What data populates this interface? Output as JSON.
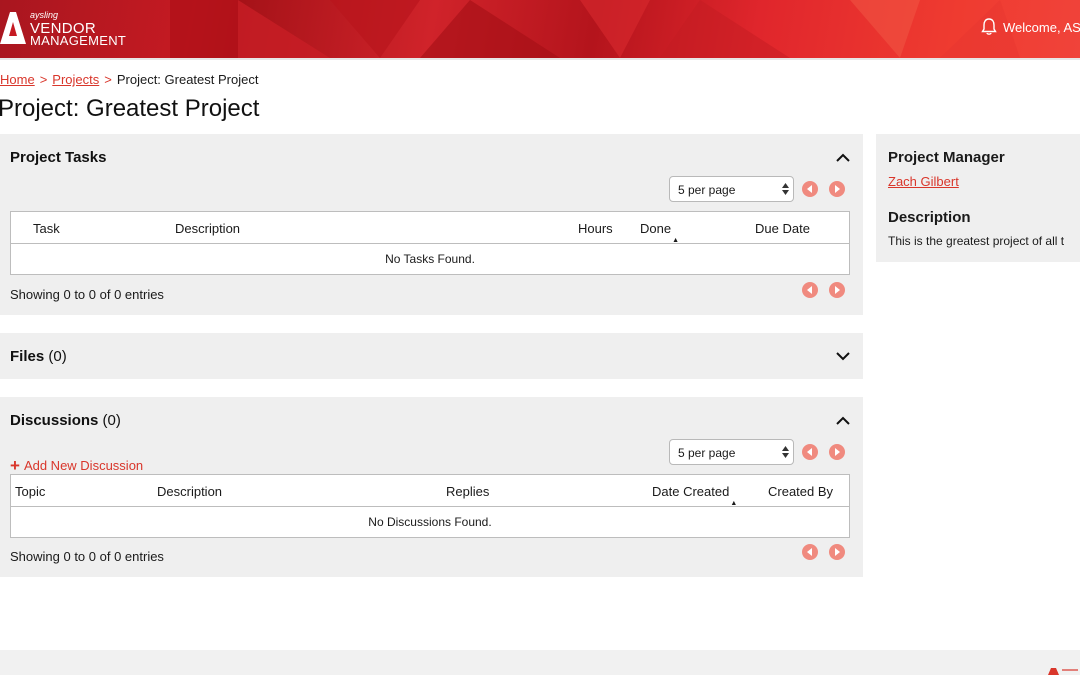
{
  "brand": {
    "small": "aysling",
    "line1": "VENDOR",
    "line2": "MANAGEMENT",
    "accent": "#d9362b"
  },
  "header": {
    "welcome": "Welcome, ASO"
  },
  "breadcrumb": {
    "home": "Home",
    "projects": "Projects",
    "current": "Project: Greatest Project"
  },
  "page": {
    "title": "Project: Greatest Project"
  },
  "tasks": {
    "title": "Project Tasks",
    "per_page": "5 per page",
    "columns": [
      "Task",
      "Description",
      "Hours",
      "Done",
      "Due Date"
    ],
    "empty": "No Tasks Found.",
    "showing": "Showing 0 to 0 of 0 entries"
  },
  "files": {
    "title": "Files",
    "count": "(0)"
  },
  "discussions": {
    "title": "Discussions",
    "count": "(0)",
    "add_label": "Add New Discussion",
    "per_page": "5 per page",
    "columns": [
      "Topic",
      "Description",
      "Replies",
      "Date Created",
      "Created By"
    ],
    "empty": "No Discussions Found.",
    "showing": "Showing 0 to 0 of 0 entries"
  },
  "side": {
    "manager_heading": "Project Manager",
    "manager_name": "Zach Gilbert",
    "description_heading": "Description",
    "description_text": "This is the greatest project of all t"
  },
  "icons": {
    "bell": "bell-icon",
    "chevron_up": "chevron-up-icon",
    "chevron_down": "chevron-down-icon",
    "prev": "prev-page-icon",
    "next": "next-page-icon",
    "plus": "plus-icon"
  }
}
